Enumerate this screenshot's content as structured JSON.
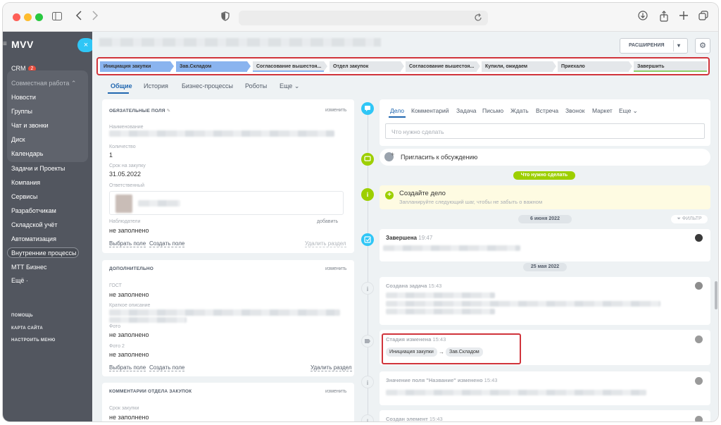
{
  "browser": {
    "icons": [
      "sidebar-toggle-icon",
      "back-icon",
      "forward-icon",
      "shield-icon",
      "reload-icon",
      "download-icon",
      "share-icon",
      "new-tab-icon",
      "tabs-overview-icon"
    ]
  },
  "sidebar": {
    "logo": "MVV",
    "close": "×",
    "crm_label": "CRM",
    "crm_badge": "2",
    "items": [
      {
        "label": "Совместная работа ⌃"
      },
      {
        "label": "Новости"
      },
      {
        "label": "Группы"
      },
      {
        "label": "Чат и звонки"
      },
      {
        "label": "Диск"
      },
      {
        "label": "Календарь"
      },
      {
        "label": "Задачи и Проекты"
      },
      {
        "label": "Компания"
      },
      {
        "label": "Сервисы"
      },
      {
        "label": "Разработчикам"
      },
      {
        "label": "Складской учёт"
      },
      {
        "label": "Автоматизация"
      },
      {
        "label": "Внутренние процессы"
      },
      {
        "label": "МТТ Бизнес"
      },
      {
        "label": "Ещё ·"
      }
    ],
    "footer": [
      "ПОМОЩЬ",
      "КАРТА САЙТА",
      "НАСТРОИТЬ МЕНЮ"
    ]
  },
  "header": {
    "extensions_label": "РАСШИРЕНИЯ",
    "extensions_caret": "▾",
    "gear": "⚙"
  },
  "stages": [
    {
      "label": "Инициация закупки"
    },
    {
      "label": "Зав.Складом"
    },
    {
      "label": "Согласование вышестоя..."
    },
    {
      "label": "Отдел закупок"
    },
    {
      "label": "Согласование вышестоя..."
    },
    {
      "label": "Купили, ожидаем"
    },
    {
      "label": "Приехало"
    },
    {
      "label": "Завершить"
    }
  ],
  "tabs": [
    {
      "label": "Общие"
    },
    {
      "label": "История"
    },
    {
      "label": "Бизнес-процессы"
    },
    {
      "label": "Роботы"
    },
    {
      "label": "Еще ⌄"
    }
  ],
  "required_card": {
    "header": "ОБЯЗАТЕЛЬНЫЕ ПОЛЯ",
    "edit_icon": "✎",
    "action": "изменить",
    "name_label": "Наименование",
    "qty_label": "Количество",
    "qty_value": "1",
    "deadline_label": "Срок на закупку",
    "deadline_value": "31.05.2022",
    "responsible_label": "Ответственный",
    "observers_label": "Наблюдатели",
    "observers_add": "добавить",
    "observers_value": "не заполнено",
    "select_field": "Выбрать поле",
    "create_field": "Создать поле",
    "delete_section": "Удалить раздел"
  },
  "additional_card": {
    "header": "ДОПОЛНИТЕЛЬНО",
    "action": "изменить",
    "gost_label": "ГОСТ",
    "gost_value": "не заполнено",
    "desc_label": "Краткое описание",
    "photo_label": "Фото",
    "photo_value": "не заполнено",
    "photo2_label": "Фото 2",
    "photo2_value": "не заполнено",
    "select_field": "Выбрать поле",
    "create_field": "Создать поле",
    "delete_section": "Удалить раздел"
  },
  "comments_card": {
    "header": "КОММЕНТАРИИ ОТДЕЛА ЗАКУПОК",
    "action": "изменить",
    "term_label": "Срок закупки",
    "term_value": "не заполнено"
  },
  "activity": {
    "tabs": [
      {
        "label": "Дело"
      },
      {
        "label": "Комментарий"
      },
      {
        "label": "Задача"
      },
      {
        "label": "Письмо"
      },
      {
        "label": "Ждать"
      },
      {
        "label": "Встреча"
      },
      {
        "label": "Звонок"
      },
      {
        "label": "Маркет"
      },
      {
        "label": "Еще ⌄"
      }
    ],
    "input_placeholder": "Что нужно сделать",
    "invite_label": "Пригласить к обсуждению",
    "todo_pill": "Что нужно сделать",
    "create_title": "Создайте дело",
    "create_hint": "Запланируйте следующий шаг, чтобы не забыть о важном",
    "create_plus": "+",
    "date1": "6 июня 2022",
    "filter_label": "ФИЛЬТР",
    "completed_title": "Завершена",
    "completed_time": "19:47",
    "date2": "25 мая 2022",
    "task_created": "Создана задача",
    "task_time": "15:43",
    "stage_changed": "Стадия изменена",
    "stage_time": "15:43",
    "stage_from": "Инициация закупки",
    "stage_arrow": "→",
    "stage_to": "Зав.Складом",
    "field_changed": "Значение поля \"Название\" изменено",
    "field_time": "15:43",
    "element_created": "Создан элемент",
    "element_time": "15:43",
    "icon_i": "i"
  },
  "colors": {
    "accent": "#2fc6f6",
    "stage_active": "#8ab4ef",
    "green": "#9dcf00",
    "highlight": "#d0343b",
    "sidebar": "#52565f"
  }
}
